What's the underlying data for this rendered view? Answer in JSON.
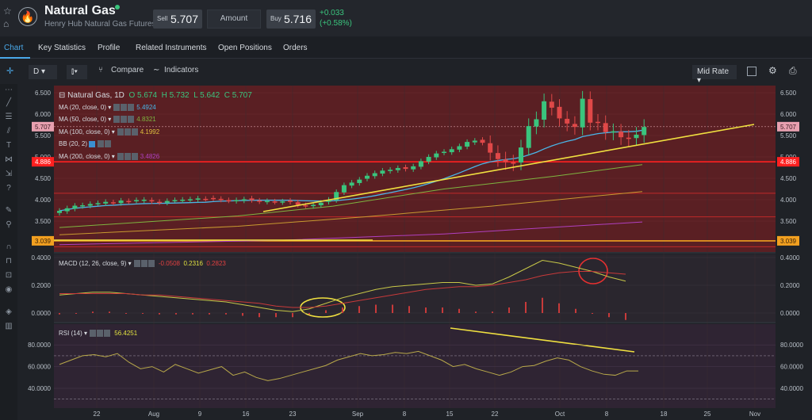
{
  "header": {
    "title": "Natural Gas",
    "subtitle": "Henry Hub Natural Gas Futures",
    "sell_label": "Sell",
    "sell_price": "5.707",
    "amount_placeholder": "Amount",
    "buy_label": "Buy",
    "buy_price": "5.716",
    "change_abs": "+0.033",
    "change_pct": "(+0.58%)"
  },
  "tabs": [
    "Chart",
    "Key Statistics",
    "Profile",
    "Related Instruments",
    "Open Positions",
    "Orders"
  ],
  "toolbar": {
    "interval": "D",
    "compare": "Compare",
    "indicators": "Indicators",
    "rate": "Mid Rate"
  },
  "legend": {
    "main": "Natural Gas, 1D",
    "o": "O 5.674",
    "h": "H 5.732",
    "l": "L 5.642",
    "c": "C 5.707",
    "ma20": "MA (20, close, 0)",
    "ma20_val": "5.4924",
    "ma50": "MA (50, close, 0)",
    "ma50_val": "4.8321",
    "ma100": "MA (100, close, 0)",
    "ma100_val": "4.1992",
    "bb": "BB (20, 2)",
    "ma200": "MA (200, close, 0)",
    "ma200_val": "3.4826",
    "macd": "MACD (12, 26, close, 9)",
    "macd_hist": "-0.0508",
    "macd_line": "0.2316",
    "macd_signal": "0.2823",
    "rsi": "RSI (14)",
    "rsi_val": "56.4251"
  },
  "axes": {
    "price_ticks": [
      "6.500",
      "6.000",
      "5.500",
      "5.000",
      "4.500",
      "4.000",
      "3.500"
    ],
    "macd_ticks": [
      "0.4000",
      "0.2000",
      "0.0000"
    ],
    "rsi_ticks": [
      "80.0000",
      "60.0000",
      "40.0000"
    ],
    "x_ticks": [
      "22",
      "Aug",
      "9",
      "16",
      "23",
      "Sep",
      "8",
      "15",
      "22",
      "Oct",
      "8",
      "18",
      "25",
      "Nov"
    ],
    "price_badges": {
      "last": "5.707",
      "level_high": "4.886",
      "level_low": "3.039"
    }
  },
  "chart_data": {
    "type": "candlestick",
    "title": "Natural Gas, 1D",
    "ylim": [
      3.0,
      6.6
    ],
    "closes": [
      3.74,
      3.8,
      3.86,
      3.87,
      3.9,
      3.92,
      3.95,
      3.93,
      3.98,
      3.96,
      3.99,
      4.0,
      3.96,
      3.94,
      3.97,
      3.99,
      4.0,
      4.01,
      4.03,
      4.02,
      4.03,
      4.0,
      3.98,
      3.99,
      4.01,
      3.99,
      3.96,
      3.97,
      3.95,
      3.96,
      3.95,
      3.88,
      3.86,
      3.88,
      3.93,
      4.0,
      4.18,
      4.34,
      4.4,
      4.47,
      4.56,
      4.62,
      4.68,
      4.7,
      4.74,
      4.72,
      4.78,
      4.9,
      5.0,
      5.08,
      5.12,
      5.18,
      5.25,
      5.35,
      5.38,
      5.33,
      5.1,
      4.95,
      4.88,
      4.85,
      5.22,
      5.72,
      5.88,
      6.3,
      6.15,
      5.9,
      5.78,
      5.7,
      6.36,
      5.8,
      5.8,
      5.58,
      5.6,
      5.46,
      5.42,
      5.52,
      5.7
    ],
    "macd": {
      "hist": -0.0508,
      "macd": 0.2316,
      "signal": 0.2823
    },
    "rsi": 56.4251,
    "horizontal_levels": [
      4.886,
      3.039
    ]
  }
}
